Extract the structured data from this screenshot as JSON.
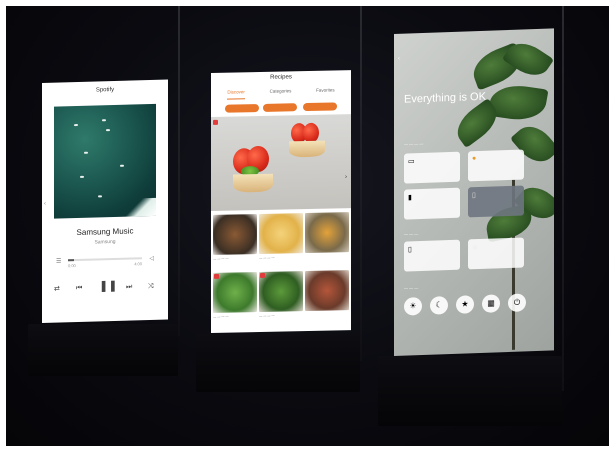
{
  "music": {
    "title": "Spotify",
    "song": "Samsung Music",
    "artist": "Samsung",
    "progress": 0.08,
    "time_start": "0:00",
    "time_end": "4:00",
    "icons": [
      "repeat-icon",
      "previous-icon",
      "pause-icon",
      "next-icon",
      "shuffle-icon"
    ]
  },
  "recipes": {
    "title": "Recipes",
    "tabs": [
      "Discover",
      "Categories",
      "Favorites"
    ],
    "accent": "#e8762b"
  },
  "home": {
    "headline": "Everything is OK"
  }
}
